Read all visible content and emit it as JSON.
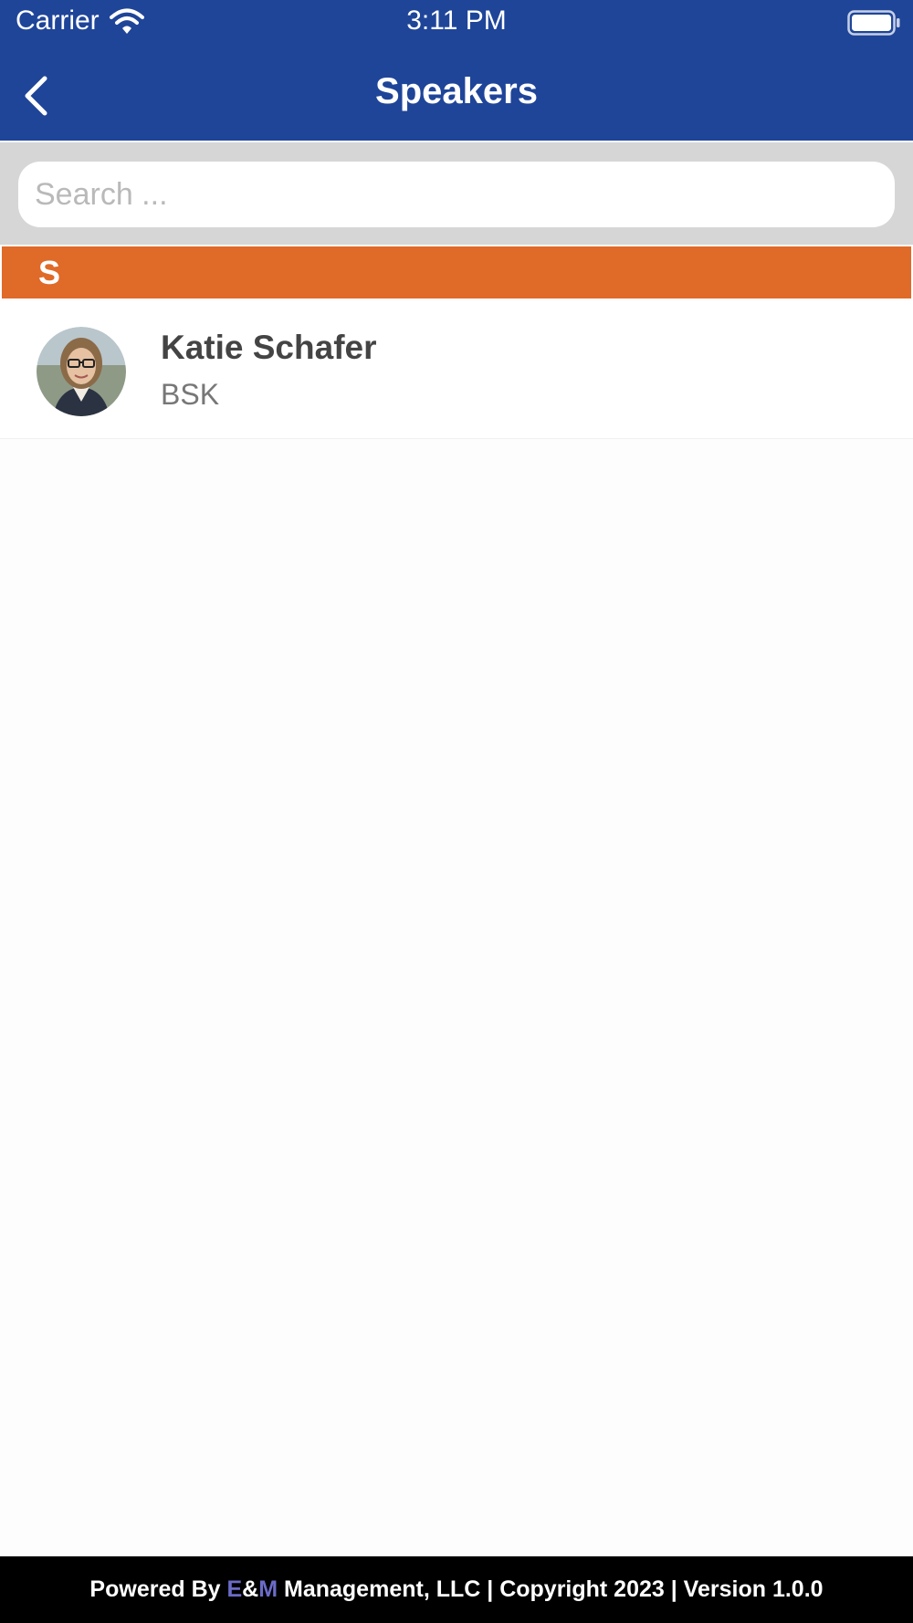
{
  "status_bar": {
    "carrier": "Carrier",
    "time": "3:11 PM",
    "icons": [
      "wifi-icon",
      "battery-icon"
    ]
  },
  "nav": {
    "title": "Speakers",
    "back_icon": "chevron-left-icon"
  },
  "search": {
    "placeholder": "Search ...",
    "value": ""
  },
  "sections": [
    {
      "letter": "S",
      "items": [
        {
          "name": "Katie Schafer",
          "organization": "BSK",
          "avatar": "speaker-photo"
        }
      ]
    }
  ],
  "footer": {
    "prefix": "Powered By ",
    "brand_e": "E",
    "brand_amp": "&",
    "brand_m": "M",
    "suffix": " Management, LLC | Copyright 2023 | Version 1.0.0"
  },
  "colors": {
    "nav_background": "#1f4599",
    "section_header": "#e06a28",
    "search_area": "#d6d6d6",
    "footer_background": "#000000",
    "footer_brand": "#6b6bc8"
  }
}
